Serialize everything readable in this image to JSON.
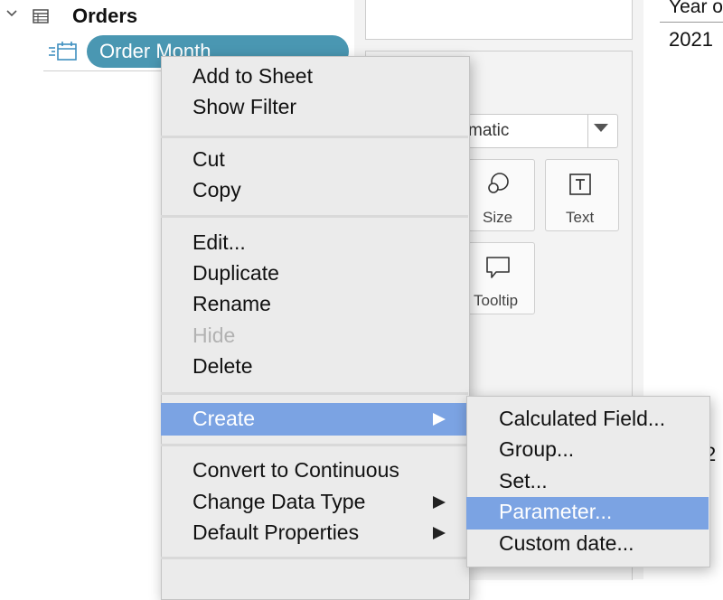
{
  "data_pane": {
    "table_name": "Orders",
    "selected_field": "Order Month"
  },
  "marks_card": {
    "mark_type_value": "matic",
    "buttons": [
      {
        "label": "Size"
      },
      {
        "label": "Text"
      },
      {
        "label": "Tooltip"
      }
    ]
  },
  "view": {
    "column_header": "Year o",
    "first_value": "2021",
    "partial_value": "2"
  },
  "context_menu": {
    "items": [
      {
        "label": "Add to Sheet"
      },
      {
        "label": "Show Filter"
      },
      {
        "label": "Cut"
      },
      {
        "label": "Copy"
      },
      {
        "label": "Edit..."
      },
      {
        "label": "Duplicate"
      },
      {
        "label": "Rename"
      },
      {
        "label": "Hide",
        "disabled": true
      },
      {
        "label": "Delete"
      },
      {
        "label": "Create",
        "highlighted": true,
        "has_submenu": true
      },
      {
        "label": "Convert to Continuous"
      },
      {
        "label": "Change Data Type",
        "has_submenu": true
      },
      {
        "label": "Default Properties",
        "has_submenu": true
      }
    ]
  },
  "submenu": {
    "items": [
      {
        "label": "Calculated Field..."
      },
      {
        "label": "Group..."
      },
      {
        "label": "Set..."
      },
      {
        "label": "Parameter...",
        "highlighted": true
      },
      {
        "label": "Custom date..."
      }
    ]
  },
  "colors": {
    "field_pill": "#4a97b2",
    "menu_highlight": "#7ba3e3",
    "menu_background": "#ebebeb"
  }
}
